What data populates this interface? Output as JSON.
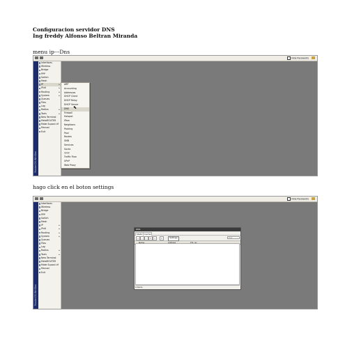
{
  "doc": {
    "title_line1": "Configuracion servidor DNS",
    "title_line2": "Ing freddy Alfonso  Beltran Miranda",
    "caption1": "menu ip---Dns",
    "caption2": "hago click en el boton  settings"
  },
  "winbox": {
    "hide_passwords": "Hide Passwords",
    "strip_label": "RouterOS WinBox",
    "menu": [
      "Interfaces",
      "Wireless",
      "Bridge",
      "PPP",
      "Switch",
      "Mesh",
      "IP",
      "IPv6",
      "Routing",
      "System",
      "Queues",
      "Files",
      "Log",
      "Radius",
      "Tools",
      "New Terminal",
      "MetaROUTER",
      "Make Supout.rif",
      "Manual",
      "Exit"
    ],
    "ip_submenu": [
      "ARP",
      "Accounting",
      "Addresses",
      "DHCP Client",
      "DHCP Relay",
      "DHCP Server",
      "DNS",
      "Firewall",
      "Hotspot",
      "IPsec",
      "Neighbors",
      "Packing",
      "Pool",
      "Routes",
      "SMB",
      "Services",
      "Socks",
      "TFTP",
      "Traffic Flow",
      "UPnP",
      "Web Proxy"
    ]
  },
  "dns_dialog": {
    "title": "DNS",
    "tabs": [
      "Static",
      "Cache"
    ],
    "settings_label": "Settings",
    "find_placeholder": "Find",
    "col_name": "Name",
    "col_address": "Address",
    "col_ttl": "TTL (s)",
    "status": "0 items"
  }
}
